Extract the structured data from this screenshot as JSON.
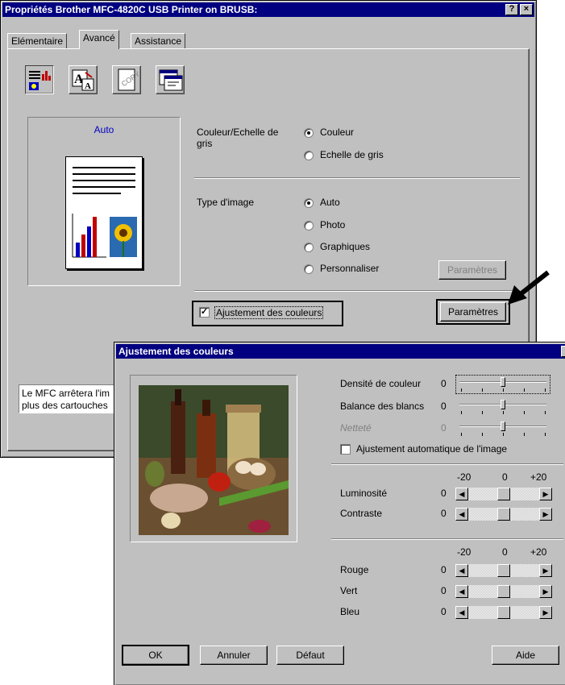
{
  "main_window": {
    "title": "Propriétés Brother MFC-4820C USB Printer on BRUSB:",
    "help_btn": "?",
    "close_btn": "×",
    "tabs": [
      "Elémentaire",
      "Avancé",
      "Assistance"
    ],
    "preview_label": "Auto",
    "color_group_label": "Couleur/Echelle de gris",
    "color_options": [
      "Couleur",
      "Echelle de gris"
    ],
    "image_type_label": "Type d'image",
    "image_type_options": [
      "Auto",
      "Photo",
      "Graphiques",
      "Personnaliser"
    ],
    "custom_params_button": "Paramètres",
    "color_adjust_checkbox": "Ajustement des couleurs",
    "color_adjust_check": "✓",
    "params_button": "Paramètres",
    "info_text_line1": "Le MFC arrêtera l'im",
    "info_text_line2": "plus des cartouches"
  },
  "dialog": {
    "title": "Ajustement des couleurs",
    "close_btn": "×",
    "sliders": [
      {
        "label": "Densité de couleur",
        "value": "0"
      },
      {
        "label": "Balance des blancs",
        "value": "0"
      },
      {
        "label": "Netteté",
        "value": "0"
      }
    ],
    "auto_adjust_checkbox": "Ajustement automatique de l'image",
    "scale_min": "-20",
    "scale_mid": "0",
    "scale_max": "+20",
    "bright_rows": [
      {
        "label": "Luminosité",
        "value": "0"
      },
      {
        "label": "Contraste",
        "value": "0"
      }
    ],
    "rgb_rows": [
      {
        "label": "Rouge",
        "value": "0"
      },
      {
        "label": "Vert",
        "value": "0"
      },
      {
        "label": "Bleu",
        "value": "0"
      }
    ],
    "buttons": {
      "ok": "OK",
      "cancel": "Annuler",
      "default": "Défaut",
      "help": "Aide"
    },
    "arrow_left": "◀",
    "arrow_right": "▶"
  }
}
